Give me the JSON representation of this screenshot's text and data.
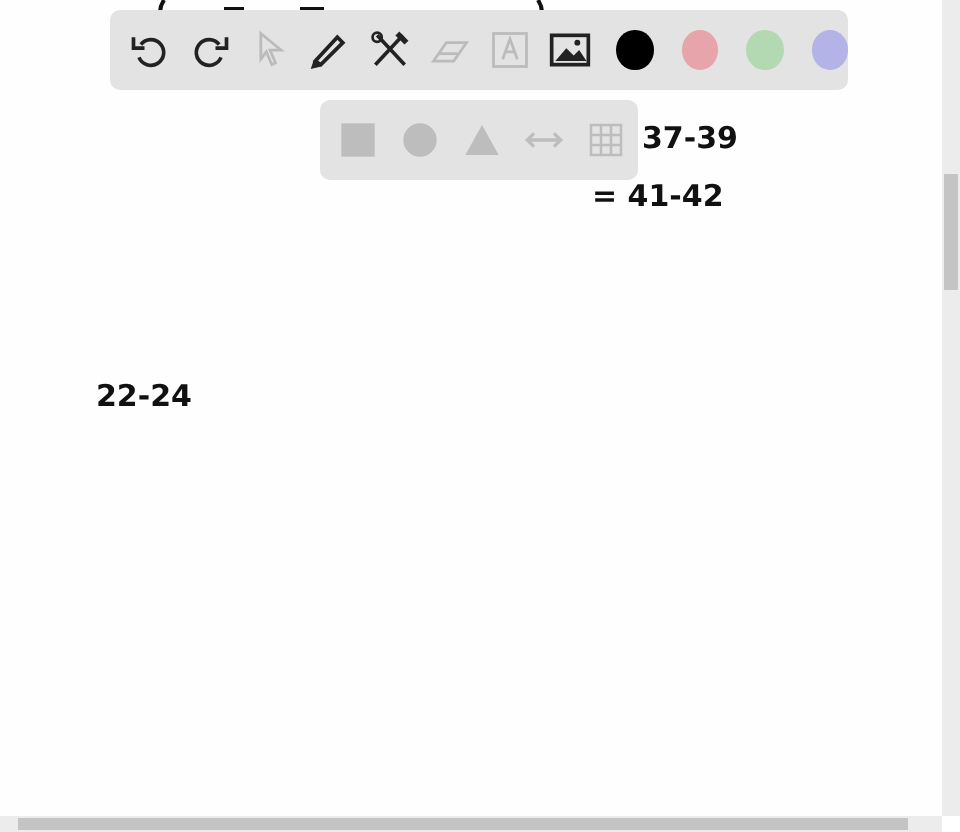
{
  "toolbar": {
    "tools": [
      {
        "kind": "undo",
        "disabled": false
      },
      {
        "kind": "redo",
        "disabled": false
      },
      {
        "kind": "pointer",
        "disabled": true
      },
      {
        "kind": "pencil",
        "disabled": false
      },
      {
        "kind": "tools",
        "disabled": false
      },
      {
        "kind": "eraser",
        "disabled": true
      },
      {
        "kind": "text",
        "disabled": true
      },
      {
        "kind": "image",
        "disabled": false
      }
    ],
    "colors": [
      {
        "color": "#000000"
      },
      {
        "color": "#e8a4ab"
      },
      {
        "color": "#b3d9b3"
      },
      {
        "color": "#b3b3e8"
      }
    ]
  },
  "shapes_panel": {
    "shapes": [
      {
        "kind": "square"
      },
      {
        "kind": "circle"
      },
      {
        "kind": "triangle"
      },
      {
        "kind": "arrow"
      },
      {
        "kind": "grid"
      }
    ]
  },
  "canvas": {
    "notes": [
      {
        "text": "37-39"
      },
      {
        "text": "= 41-42"
      },
      {
        "text": "22-24"
      }
    ]
  }
}
